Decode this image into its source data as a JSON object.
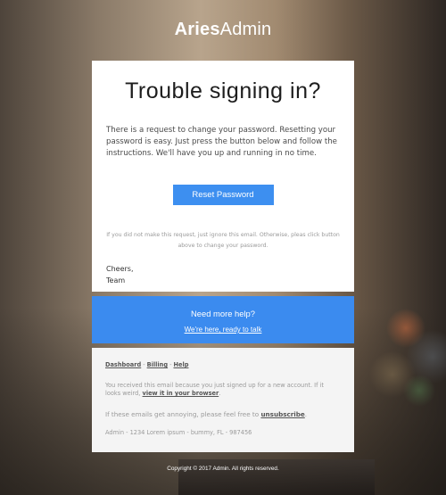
{
  "logo": {
    "bold": "Aries",
    "regular": "Admin"
  },
  "main": {
    "title": "Trouble signing in?",
    "body": "There is a request to change your password. Resetting your password is easy. Just press the button below and follow the instructions. We'll have you up and running in no time.",
    "button_label": "Reset Password",
    "note": "If you did not make this request, just ignore this email. Otherwise, pleas click button above to change your password.",
    "signoff_line1": "Cheers,",
    "signoff_line2": "Team"
  },
  "help": {
    "title": "Need more help?",
    "link": "We're here, ready to talk"
  },
  "footer": {
    "links": [
      "Dashboard",
      "Billing",
      "Help"
    ],
    "separator": "-",
    "p1_text": "You received this email because you just signed up for a new account. If it looks weird,",
    "p1_link": "view it in your browser",
    "p1_end": ".",
    "p2_text": "If these emails get annoying, please feel free to",
    "p2_link": "unsubscribe",
    "p2_end": ".",
    "address": "Admin - 1234 Lorem ipsum - bummy, FL - 987456"
  },
  "copyright": "Copyright © 2017 Admin. All rights reserved."
}
